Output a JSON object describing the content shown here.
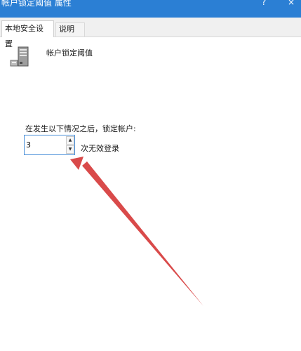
{
  "window": {
    "title": "帐户锁定阈值 属性",
    "help_label": "?",
    "close_label": "×"
  },
  "tabs": [
    {
      "label": "本地安全设置",
      "active": true
    },
    {
      "label": "说明",
      "active": false
    }
  ],
  "policy": {
    "icon": "server-policy-icon",
    "title": "帐户锁定阈值",
    "prompt": "在发生以下情况之后，锁定帐户:",
    "value": "3",
    "unit": "次无效登录"
  },
  "colors": {
    "titlebar": "#2b7fd4",
    "annotation_arrow": "#d94a4a"
  }
}
